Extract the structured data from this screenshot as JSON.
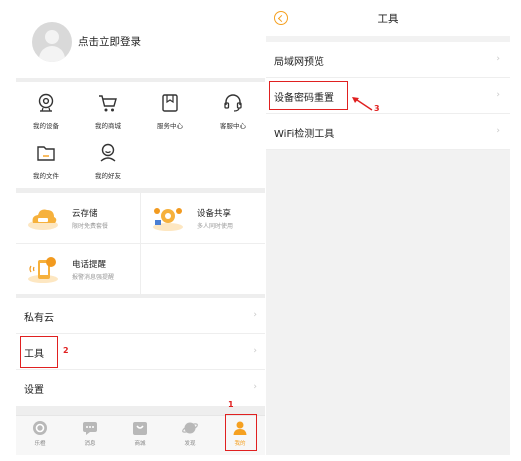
{
  "profile": {
    "login_text": "点击立即登录"
  },
  "grid": [
    {
      "label": "我的设备",
      "icon": "camera-icon"
    },
    {
      "label": "我的商城",
      "icon": "shopping-cart-icon"
    },
    {
      "label": "服务中心",
      "icon": "service-center-icon"
    },
    {
      "label": "客服中心",
      "icon": "headset-icon"
    },
    {
      "label": "我的文件",
      "icon": "folder-icon"
    },
    {
      "label": "我的好友",
      "icon": "friend-icon"
    }
  ],
  "cards": [
    {
      "title": "云存储",
      "subtitle": "限时免费套餐",
      "icon": "cloud-storage-icon"
    },
    {
      "title": "设备共享",
      "subtitle": "多人同时使用",
      "icon": "device-share-icon"
    },
    {
      "title": "电话提醒",
      "subtitle": "报警消息强提醒",
      "icon": "phone-alert-icon"
    }
  ],
  "menu": {
    "private_cloud": "私有云",
    "tools": "工具",
    "settings": "设置"
  },
  "tabs": [
    {
      "label": "乐橙",
      "icon": "home-icon"
    },
    {
      "label": "消息",
      "icon": "message-icon"
    },
    {
      "label": "商城",
      "icon": "mall-icon"
    },
    {
      "label": "发现",
      "icon": "discover-icon"
    },
    {
      "label": "我的",
      "icon": "person-icon"
    }
  ],
  "annotations": {
    "n1": "1",
    "n2": "2",
    "n3": "3"
  },
  "tools_page": {
    "title": "工具",
    "items": [
      "局域网预览",
      "设备密码重置",
      "WiFi检测工具"
    ]
  },
  "colors": {
    "accent": "#f5a020",
    "annotation": "#e02020"
  }
}
